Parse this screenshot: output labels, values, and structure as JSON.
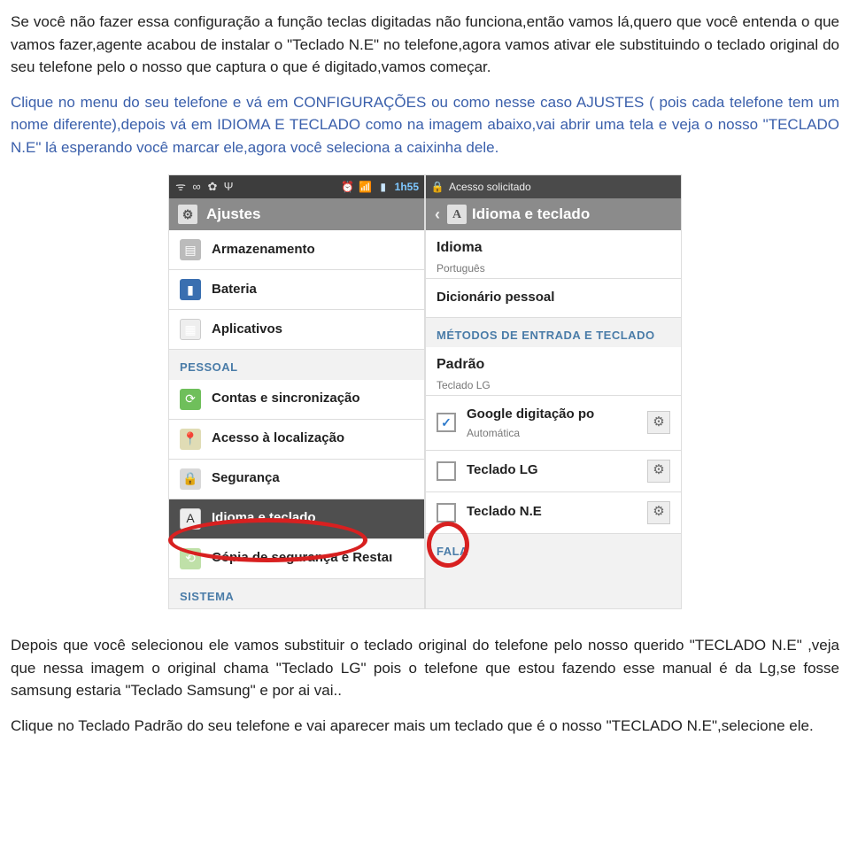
{
  "para1": "Se você não fazer essa configuração a função teclas digitadas não funciona,então vamos lá,quero que você entenda o que vamos fazer,agente acabou de instalar o \"Teclado N.E\" no telefone,agora vamos ativar ele substituindo o teclado original do seu telefone pelo o nosso que captura o que é digitado,vamos começar.",
  "para2": "Clique no menu do seu telefone e vá em CONFIGURAÇÕES ou como nesse caso AJUSTES ( pois cada telefone tem um nome diferente),depois vá em IDIOMA E TECLADO como na imagem abaixo,vai abrir uma tela e veja o nosso \"TECLADO N.E\" lá esperando você marcar ele,agora você seleciona a caixinha dele.",
  "para3": "Depois que você selecionou ele vamos substituir o teclado original do telefone pelo nosso querido \"TECLADO N.E\" ,veja que nessa imagem o original chama \"Teclado LG\" pois o telefone que estou fazendo esse manual é da Lg,se fosse samsung estaria \"Teclado Samsung\" e por ai vai..",
  "para4": "Clique no Teclado Padrão do seu telefone e vai aparecer mais um teclado que é o nosso \"TECLADO N.E\",selecione ele.",
  "left": {
    "time": "1h55",
    "header": "Ajustes",
    "items": {
      "storage": "Armazenamento",
      "battery": "Bateria",
      "apps": "Aplicativos",
      "sec_personal": "PESSOAL",
      "accounts": "Contas e sincronização",
      "location": "Acesso à localização",
      "security": "Segurança",
      "language": "Idioma e teclado",
      "backup": "Cópia de segurança e Restaı",
      "sec_system": "SISTEMA"
    }
  },
  "right": {
    "status": "Acesso solicitado",
    "header": "Idioma e teclado",
    "lang_title": "Idioma",
    "lang_sub": "Português",
    "dict": "Dicionário pessoal",
    "sec_methods": "MÉTODOS DE ENTRADA E TECLADO",
    "default_title": "Padrão",
    "default_sub": "Teclado LG",
    "google_title": "Google digitação po",
    "google_sub": "Automática",
    "lg_kbd": "Teclado LG",
    "ne_kbd": "Teclado N.E",
    "sec_speech": "FALA"
  }
}
